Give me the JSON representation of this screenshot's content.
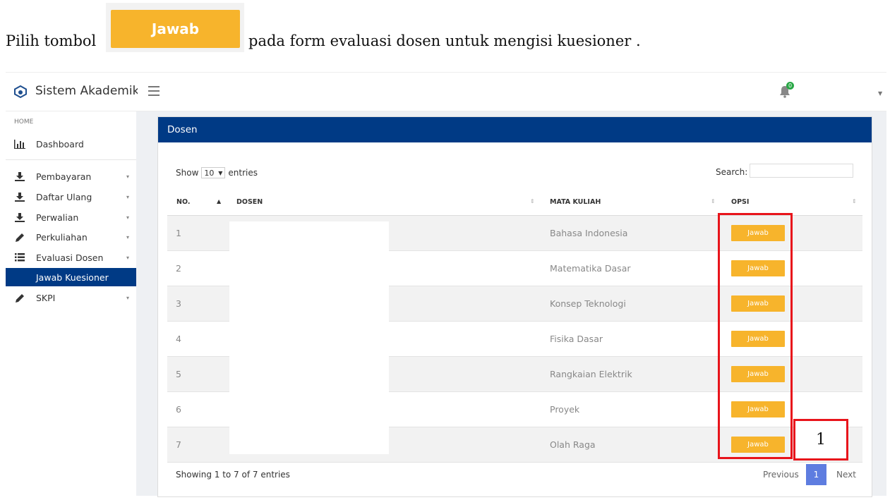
{
  "instruction": {
    "before": "Pilih tombol",
    "button_label": "Jawab",
    "after": "pada form evaluasi dosen untuk mengisi kuesioner ."
  },
  "header": {
    "app_title": "Sistem Akademik",
    "notification_count": "0"
  },
  "sidebar": {
    "section_label": "HOME",
    "dashboard": "Dashboard",
    "items": [
      {
        "label": "Pembayaran",
        "icon": "download-icon"
      },
      {
        "label": "Daftar Ulang",
        "icon": "download-icon"
      },
      {
        "label": "Perwalian",
        "icon": "download-icon"
      },
      {
        "label": "Perkuliahan",
        "icon": "pencil-icon"
      },
      {
        "label": "Evaluasi Dosen",
        "icon": "list-icon"
      }
    ],
    "active_subitem": "Jawab Kuesioner",
    "last_item": {
      "label": "SKPI",
      "icon": "pencil-icon"
    }
  },
  "card": {
    "title": "Dosen",
    "show_label": "Show",
    "entries_value": "10",
    "entries_label": "entries",
    "search_label": "Search:",
    "columns": {
      "no": "NO.",
      "dosen": "DOSEN",
      "mata_kuliah": "MATA KULIAH",
      "opsi": "OPSI"
    },
    "rows": [
      {
        "no": "1",
        "mata_kuliah": "Bahasa Indonesia",
        "action": "Jawab"
      },
      {
        "no": "2",
        "mata_kuliah": "Matematika Dasar",
        "action": "Jawab"
      },
      {
        "no": "3",
        "mata_kuliah": "Konsep Teknologi",
        "action": "Jawab"
      },
      {
        "no": "4",
        "mata_kuliah": "Fisika Dasar",
        "action": "Jawab"
      },
      {
        "no": "5",
        "mata_kuliah": "Rangkaian Elektrik",
        "action": "Jawab"
      },
      {
        "no": "6",
        "mata_kuliah": "Proyek",
        "action": "Jawab"
      },
      {
        "no": "7",
        "mata_kuliah": "Olah Raga",
        "action": "Jawab"
      }
    ],
    "info": "Showing 1 to 7 of 7 entries",
    "pagination": {
      "previous": "Previous",
      "current": "1",
      "next": "Next"
    }
  },
  "annotation": {
    "label": "1",
    "color": "#e8141b"
  },
  "colors": {
    "primary": "#003a85",
    "button": "#f7b42c",
    "page_active": "#5e7de0"
  }
}
